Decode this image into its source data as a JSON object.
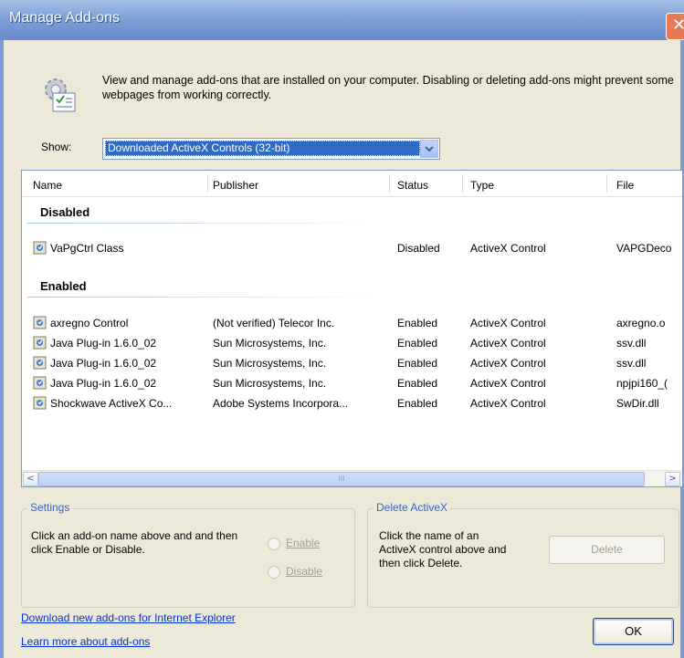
{
  "window": {
    "title": "Manage Add-ons",
    "close_glyph": "✕"
  },
  "header": {
    "description": "View and manage add-ons that are installed on your computer. Disabling or deleting add-ons might prevent some webpages from working correctly."
  },
  "show": {
    "label": "Show:",
    "selected": "Downloaded ActiveX Controls (32-bit)"
  },
  "list": {
    "columns": [
      "Name",
      "Publisher",
      "Status",
      "Type",
      "File"
    ],
    "groups": [
      {
        "label": "Disabled",
        "rows": [
          {
            "name": "VaPgCtrl Class",
            "publisher": "",
            "status": "Disabled",
            "type": "ActiveX Control",
            "file": "VAPGDeco"
          }
        ]
      },
      {
        "label": "Enabled",
        "rows": [
          {
            "name": "axregno Control",
            "publisher": "(Not verified) Telecor Inc.",
            "status": "Enabled",
            "type": "ActiveX Control",
            "file": "axregno.o"
          },
          {
            "name": "Java Plug-in 1.6.0_02",
            "publisher": "Sun Microsystems, Inc.",
            "status": "Enabled",
            "type": "ActiveX Control",
            "file": "ssv.dll"
          },
          {
            "name": "Java Plug-in 1.6.0_02",
            "publisher": "Sun Microsystems, Inc.",
            "status": "Enabled",
            "type": "ActiveX Control",
            "file": "ssv.dll"
          },
          {
            "name": "Java Plug-in 1.6.0_02",
            "publisher": "Sun Microsystems, Inc.",
            "status": "Enabled",
            "type": "ActiveX Control",
            "file": "npjpi160_("
          },
          {
            "name": "Shockwave ActiveX Co...",
            "publisher": "Adobe Systems Incorpora...",
            "status": "Enabled",
            "type": "ActiveX Control",
            "file": "SwDir.dll"
          }
        ]
      }
    ],
    "scroll_left": "<",
    "scroll_right": ">",
    "scroll_grip": "III"
  },
  "settings": {
    "legend": "Settings",
    "text": "Click an add-on name above and and then click Enable or Disable.",
    "enable": "Enable",
    "disable": "Disable"
  },
  "delete_activex": {
    "legend": "Delete ActiveX",
    "text": "Click the name of an ActiveX control above and then click Delete.",
    "button": "Delete"
  },
  "links": {
    "download": "Download new add-ons for Internet Explorer",
    "learn": "Learn more about add-ons"
  },
  "ok": "OK"
}
